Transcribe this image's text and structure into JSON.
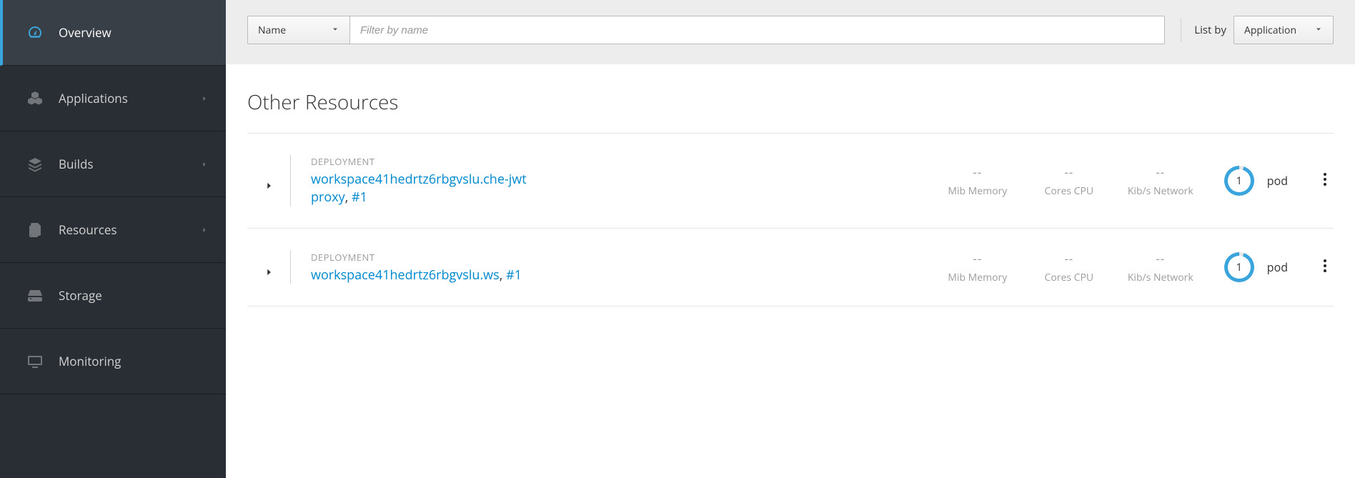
{
  "sidebar": {
    "items": [
      {
        "label": "Overview",
        "icon": "dashboard-icon",
        "active": true,
        "has_submenu": false
      },
      {
        "label": "Applications",
        "icon": "cubes-icon",
        "active": false,
        "has_submenu": true
      },
      {
        "label": "Builds",
        "icon": "layers-icon",
        "active": false,
        "has_submenu": true
      },
      {
        "label": "Resources",
        "icon": "files-icon",
        "active": false,
        "has_submenu": true
      },
      {
        "label": "Storage",
        "icon": "hdd-icon",
        "active": false,
        "has_submenu": false
      },
      {
        "label": "Monitoring",
        "icon": "monitor-icon",
        "active": false,
        "has_submenu": false
      }
    ]
  },
  "toolbar": {
    "filter_type": "Name",
    "filter_placeholder": "Filter by name",
    "filter_value": "",
    "list_by_label": "List by",
    "list_by_value": "Application"
  },
  "section": {
    "title": "Other Resources"
  },
  "metric_labels": {
    "memory": "Mib Memory",
    "cpu": "Cores CPU",
    "network": "Kib/s Network"
  },
  "pod_label_singular": "pod",
  "resources": [
    {
      "kind": "DEPLOYMENT",
      "name": "workspace41hedrtz6rbgvslu.che-jwtproxy",
      "revision": "#1",
      "memory": "--",
      "cpu": "--",
      "network": "--",
      "pods": "1"
    },
    {
      "kind": "DEPLOYMENT",
      "name": "workspace41hedrtz6rbgvslu.ws",
      "revision": "#1",
      "memory": "--",
      "cpu": "--",
      "network": "--",
      "pods": "1"
    }
  ]
}
